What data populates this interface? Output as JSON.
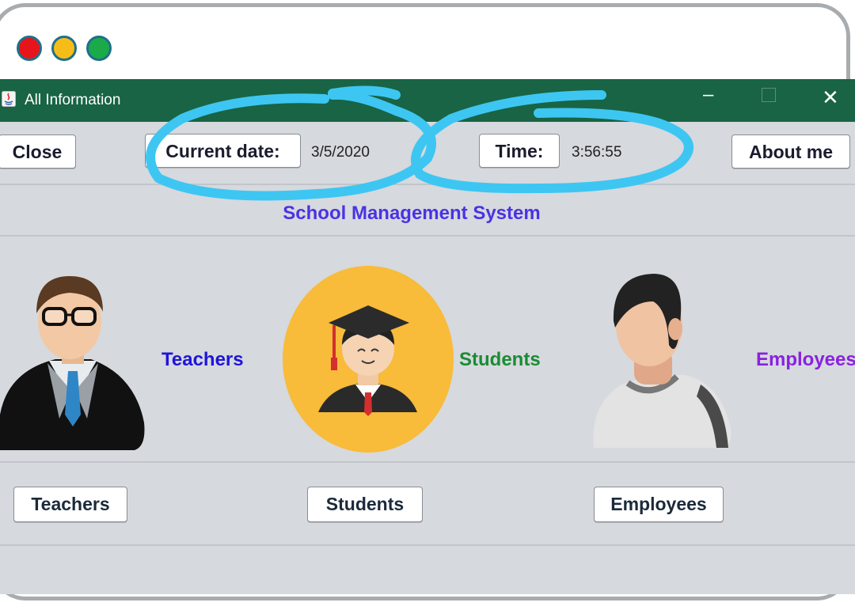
{
  "window": {
    "title": "All Information",
    "controls": {
      "minimize": "–",
      "close": "✕"
    }
  },
  "toolbar": {
    "close_label": "Close",
    "current_date_label": "Current date:",
    "current_date_value": "3/5/2020",
    "time_label": "Time:",
    "time_value": "3:56:55",
    "about_label": "About me"
  },
  "heading": "School Management System",
  "sections": {
    "teachers": {
      "label": "Teachers",
      "button": "Teachers",
      "color": "#1f14d9"
    },
    "students": {
      "label": "Students",
      "button": "Students",
      "color": "#1a8c33"
    },
    "employees": {
      "label": "Employees",
      "button": "Employees",
      "color": "#8a21e0"
    }
  },
  "colors": {
    "titlebar": "#186444",
    "panel": "#d6d9de",
    "annotation": "#3ec6f2"
  },
  "icons": [
    "java-app-icon",
    "teacher-avatar-icon",
    "graduate-student-icon",
    "employee-avatar-icon"
  ]
}
